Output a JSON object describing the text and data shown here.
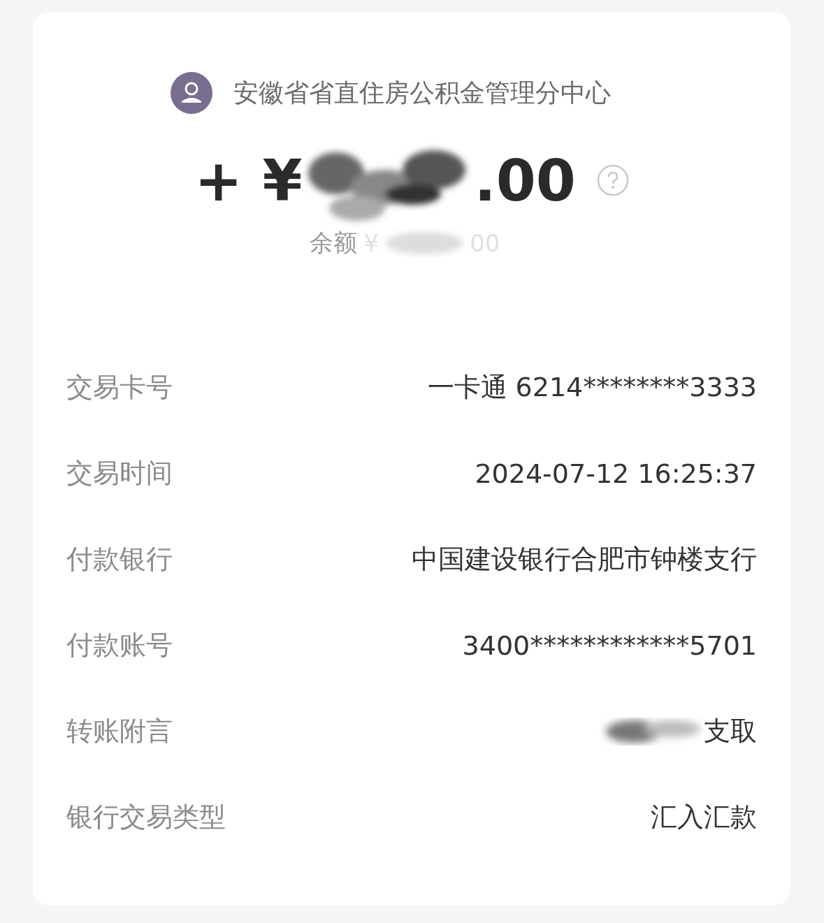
{
  "header": {
    "title": "安徽省省直住房公积金管理分中心"
  },
  "amount": {
    "prefix": "+ ¥",
    "suffix": ".00"
  },
  "balance": {
    "label": "余额",
    "currency": "¥",
    "suffix": "00"
  },
  "details": [
    {
      "label": "交易卡号",
      "value": "一卡通 6214********3333",
      "redacted": false
    },
    {
      "label": "交易时间",
      "value": "2024-07-12 16:25:37",
      "redacted": false
    },
    {
      "label": "付款银行",
      "value": "中国建设银行合肥市钟楼支行",
      "redacted": false
    },
    {
      "label": "付款账号",
      "value": "3400************5701",
      "redacted": false
    },
    {
      "label": "转账附言",
      "value": "支取",
      "redacted": true
    },
    {
      "label": "银行交易类型",
      "value": "汇入汇款",
      "redacted": false
    }
  ]
}
